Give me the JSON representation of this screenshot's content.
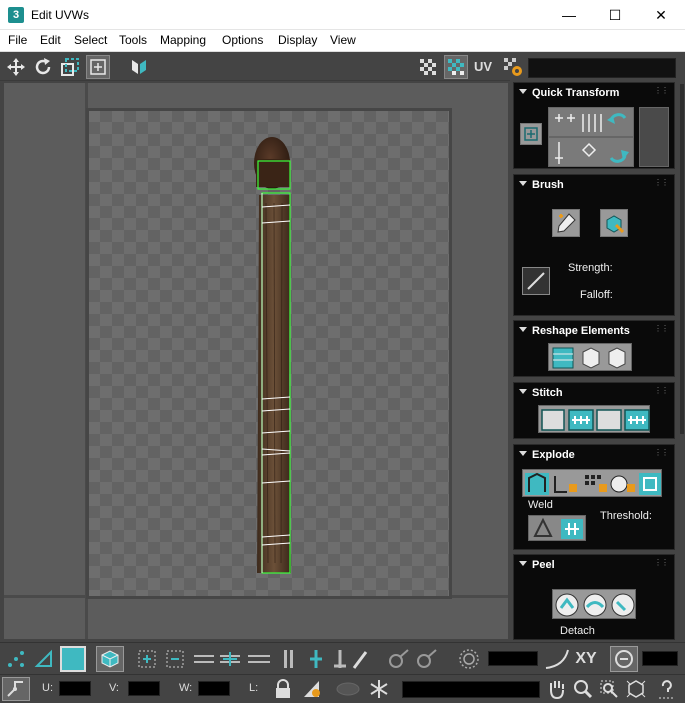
{
  "window": {
    "title": "Edit UVWs",
    "app_icon": "3",
    "minimize": "—",
    "maximize": "☐",
    "close": "✕"
  },
  "menu": [
    "File",
    "Edit",
    "Select",
    "Tools",
    "Mapping",
    "Options",
    "Display",
    "View"
  ],
  "toolbar": {
    "uv_label": "UV",
    "texture_dropdown": ""
  },
  "panels": {
    "quick_transform": {
      "title": "Quick Transform"
    },
    "brush": {
      "title": "Brush",
      "strength_label": "Strength:",
      "falloff_label": "Falloff:"
    },
    "reshape": {
      "title": "Reshape Elements"
    },
    "stitch": {
      "title": "Stitch"
    },
    "explode": {
      "title": "Explode",
      "weld_label": "Weld",
      "threshold_label": "Threshold:"
    },
    "peel": {
      "title": "Peel",
      "detach_label": "Detach"
    }
  },
  "bottom": {
    "xy_label": "XY",
    "u_label": "U:",
    "v_label": "V:",
    "w_label": "W:",
    "l_label": "L:",
    "u_value": "",
    "v_value": "",
    "w_value": "",
    "l_value": ""
  },
  "colors": {
    "accent": "#3fb9c1",
    "selection": "#3cff3c",
    "panel_bg": "#0a0a0a",
    "window_bg": "#444444"
  }
}
